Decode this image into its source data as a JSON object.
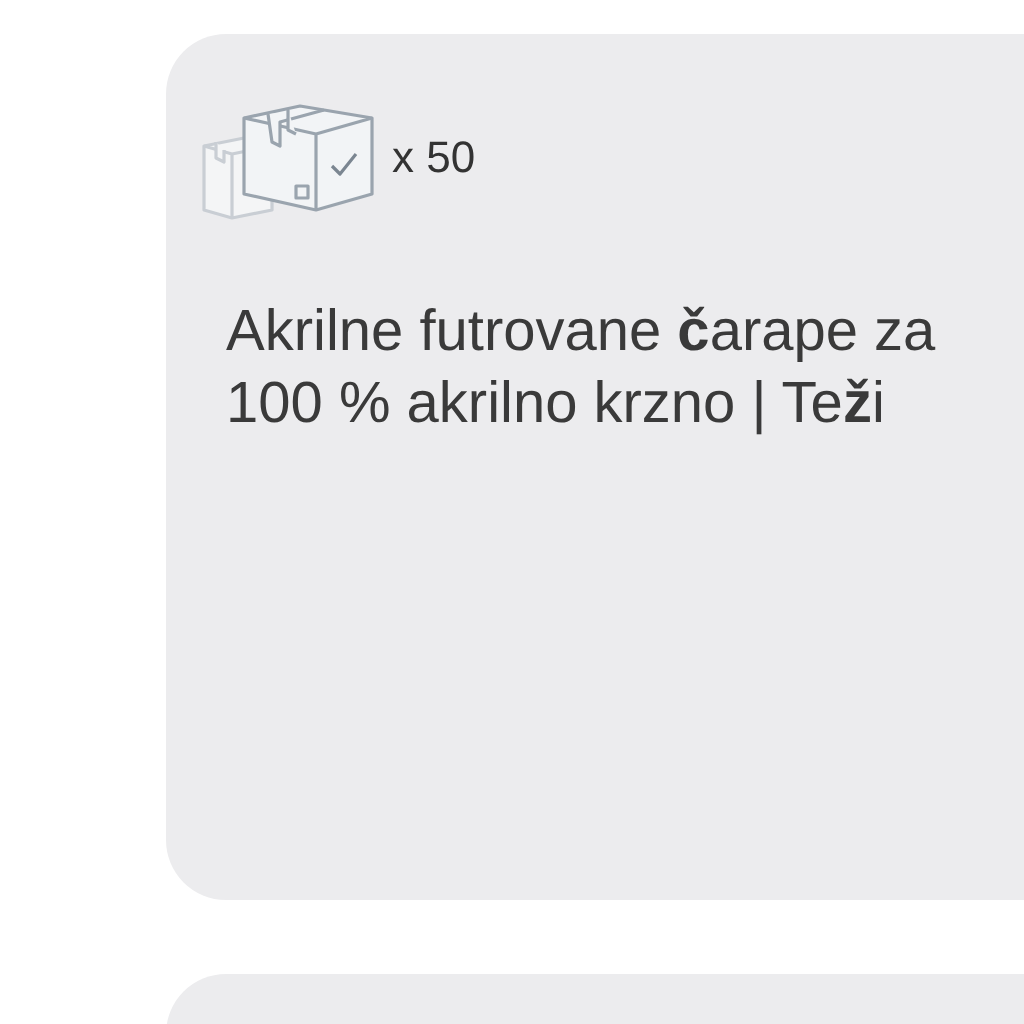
{
  "cards": [
    {
      "kind": "product",
      "quantity": "x 50",
      "description": [
        "Akrilne futrovane **č**arape za",
        "100 % akrilno krzno | Te**ž**i"
      ]
    },
    {
      "kind": "product"
    }
  ]
}
